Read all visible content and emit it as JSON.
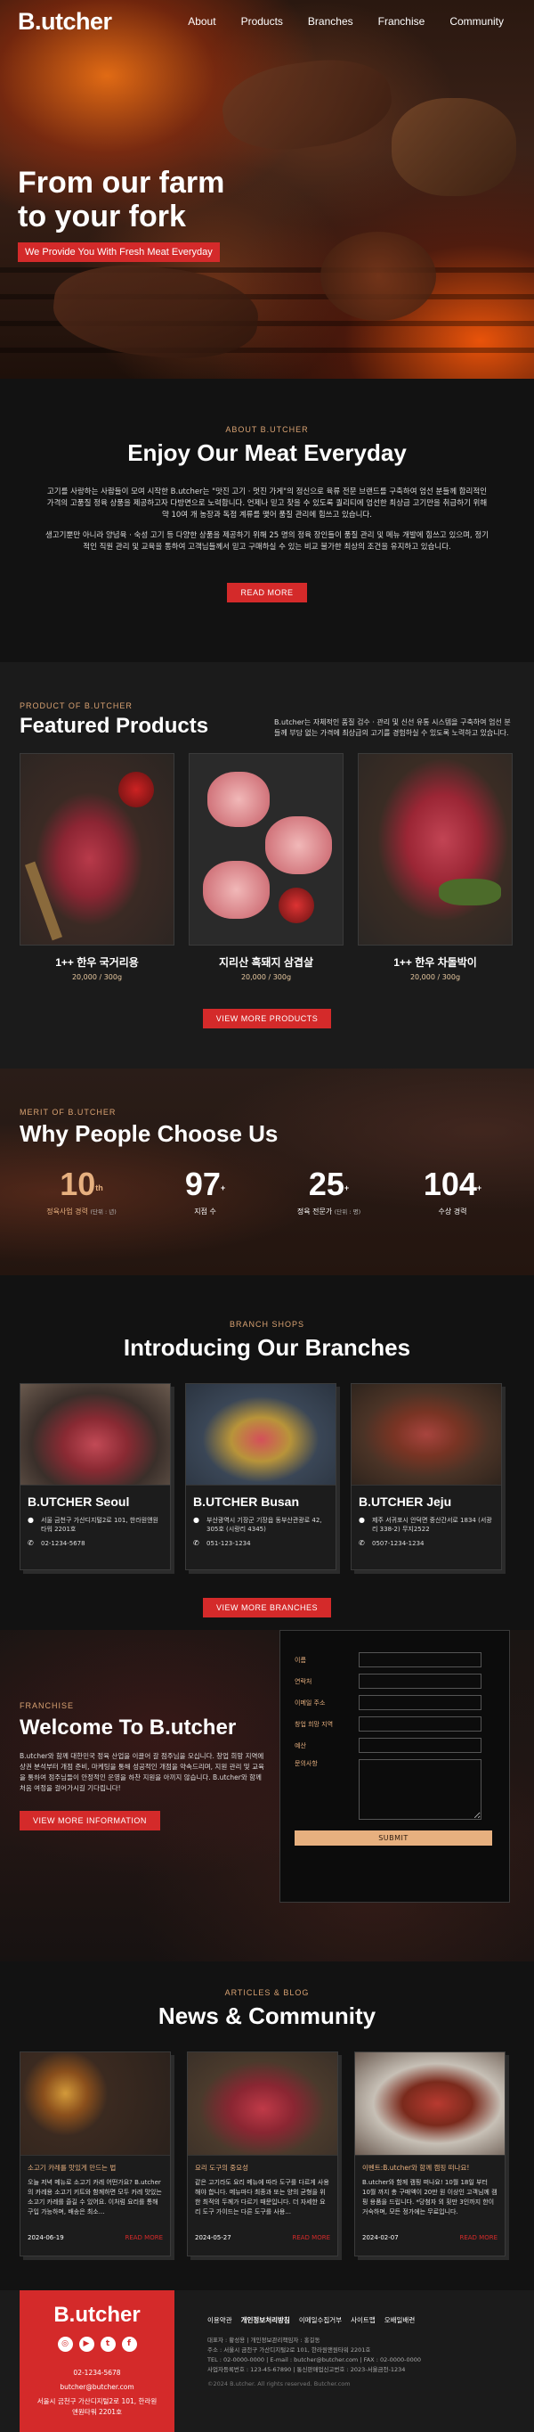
{
  "header": {
    "logo": "B.utcher",
    "nav": [
      "About",
      "Products",
      "Branches",
      "Franchise",
      "Community"
    ]
  },
  "hero": {
    "title": "From our farm\nto your fork",
    "badge": "We Provide You With Fresh Meat Everyday"
  },
  "about": {
    "eyebrow": "ABOUT B.UTCHER",
    "title": "Enjoy Our Meat Everyday",
    "paragraph1": "고기를 사랑하는 사람들이 모여 시작한 B.utcher는 \"맛진 고기 · 멋진 가게\"의 정신으로 육류 전문 브랜드를 구축하여 엄선 분들께 합리적인 가격의 고품질 정육 상품을 제공하고자 다방면으로 노력합니다. 언제나 믿고 찾을 수 있도록 퀄리티에 엄선한 최상급 고기만을 취급하기 위해 약 10여 개 농장과 독점 계류를 맺어 품질 관리에 힘쓰고 있습니다.",
    "paragraph2": "생고기뿐만 아니라 양념육 · 숙성 고기 등 다양한 상품을 제공하기 위해 25 명의 정육 장인들이 품질 관리 및 메뉴 개발에 힘쓰고 있으며, 정기적인 직원 관리 및 교육을 통하여 고객님들께서 믿고 구매하실 수 있는 비교 불가한 최상의 조건을 유지하고 있습니다.",
    "button": "READ MORE"
  },
  "featured": {
    "eyebrow": "PRODUCT OF B.UTCHER",
    "title": "Featured Products",
    "description": "B.utcher는 자체적인 품질 검수 · 관리 및 신선 유통 시스템을 구축하여 엄선 분들께 부담 없는 가격에 최상급의 고기를 경험하실 수 있도록 노력하고 있습니다.",
    "products": [
      {
        "name": "1++ 한우 국거리용",
        "price": "20,000 / 300g"
      },
      {
        "name": "지리산 흑돼지 삼겹살",
        "price": "20,000 / 300g"
      },
      {
        "name": "1++ 한우 차돌박이",
        "price": "20,000 / 300g"
      }
    ],
    "button": "VIEW MORE PRODUCTS"
  },
  "why": {
    "eyebrow": "MERIT OF B.UTCHER",
    "title": "Why People Choose Us",
    "stats": [
      {
        "value": "10",
        "sup": "th",
        "label": "정육사업 경력",
        "unit": "(단위 : 년)"
      },
      {
        "value": "97",
        "sup": "+",
        "label": "지점 수",
        "unit": ""
      },
      {
        "value": "25",
        "sup": "+",
        "label": "정육 전문가",
        "unit": "(단위 : 명)"
      },
      {
        "value": "104",
        "sup": "+",
        "label": "수상 경력",
        "unit": ""
      }
    ]
  },
  "branches": {
    "eyebrow": "BRANCH SHOPS",
    "title": "Introducing Our Branches",
    "items": [
      {
        "name": "B.UTCHER Seoul",
        "address": "서울 금천구 가산디지털2로 101, 한라원앤원타워 2201호",
        "phone": "02-1234-5678"
      },
      {
        "name": "B.UTCHER Busan",
        "address": "부산광역시 기장군 기장읍 동부산관광로 42, 305호 (시랑리 4345)",
        "phone": "051-123-1234"
      },
      {
        "name": "B.UTCHER Jeju",
        "address": "제주 서귀포시 안덕면 중산간서로 1834 (서광리 338-2) 무지2522",
        "phone": "0507-1234-1234"
      }
    ],
    "button": "VIEW MORE BRANCHES"
  },
  "franchise": {
    "eyebrow": "FRANCHISE",
    "title": "Welcome To B.utcher",
    "paragraph": "B.utcher와 함께 대한민국 정육 산업을 이끌어 갈 점주님을 모십니다. 창업 희망 지역에 상권 분석부터 개점 준비, 마케팅을 통해 성공적인 개점을 약속드리며, 지원 관리 및 교육을 통하여 점주님들이 안정적인 운영을 하찬 지원을 아끼지 않습니다. B.utcher와 함께 처음 여정을 걸어가시길 기다립니다!",
    "button": "VIEW MORE INFORMATION",
    "form": {
      "fields": [
        "이름",
        "연락처",
        "이메일 주소",
        "창업 희망 지역",
        "예산",
        "문의사항"
      ],
      "submit": "SUBMIT"
    }
  },
  "news": {
    "eyebrow": "ARTICLES & BLOG",
    "title": "News & Community",
    "items": [
      {
        "tag": "소고기 카레를 맛있게 만드는 법",
        "body": "오늘 저녁 메뉴로 소고기 카레 어떤가요? B.utcher의 카레용 소고기 키트와 함께하면 모두 카레 맛있는 소고기 카레를 즐길 수 있어요. 이처럼 요리를 통해 구입 가능하며, 배송은 최소...",
        "date": "2024-06-19",
        "more": "READ MORE"
      },
      {
        "tag": "요리 도구의 중요성",
        "body": "같은 고기라도 요리 메뉴에 따라 도구를 다르게 사용해야 합니다. 메뉴마다 최종과 또는 양의 균형을 위한 최적의 두께가 다르기 때문입니다. 더 자세한 요리 도구 가이드는 다른 도구를 사용...",
        "date": "2024-05-27",
        "more": "READ MORE"
      },
      {
        "tag": "이벤트:B.utcher와 함께 캠핑 떠나요!",
        "body": "B.utcher와 함께 캠핑 떠나요! 10월 18일 부터 10월 까지 총 구매액이 20만 원 이상인 고객님께 캠핑 용품을 드립니다. *당첨자 외 횟만 3인까지 한이 거숙하며, 모든 정가에는 무료입니다.",
        "date": "2024-02-07",
        "more": "READ MORE"
      }
    ]
  },
  "footer": {
    "logo": "B.utcher",
    "social": [
      "instagram-icon",
      "youtube-icon",
      "twitter-icon",
      "facebook-icon"
    ],
    "phone": "02-1234-5678",
    "email": "butcher@butcher.com",
    "address": "서울시 금천구 가산디지털2로 101, 한라원앤원타워 2201호",
    "links": [
      "이용약관",
      "개인정보처리방침",
      "이메일수집거부",
      "사이트맵",
      "오배일배련"
    ],
    "addr_lines": [
      "대표자 : 황성용 | 개인정보관리책임자 : 홍길동",
      "주소 : 서울시 금천구 가산디지털2로 101, 한라원앤원타워 2201호",
      "TEL : 02-0000-0000 | E-mail : butcher@butcher.com | FAX : 02-0000-0000",
      "사업자등록번호 : 123-45-67890 | 통신판매업신고번호 : 2023-서울금천-1234"
    ],
    "copyright": "©2024 B.utcher. All rights reserved. Butcher.com"
  }
}
